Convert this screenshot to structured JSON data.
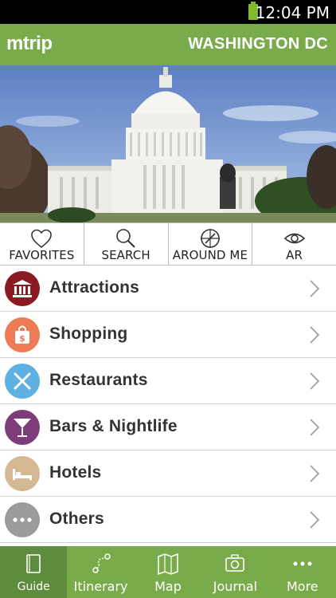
{
  "status_bar": {
    "time": "12:04 PM",
    "battery_color": "#7fba2a"
  },
  "header": {
    "logo": "mtrip",
    "city": "WASHINGTON DC",
    "color": "#7aab4a"
  },
  "hero": {
    "image": "capitol-building-photo"
  },
  "quick_actions": [
    {
      "label": "FAVORITES",
      "icon": "heart-icon"
    },
    {
      "label": "SEARCH",
      "icon": "magnifier-icon"
    },
    {
      "label": "AROUND ME",
      "icon": "crosshair-icon"
    },
    {
      "label": "AR",
      "icon": "eye-icon"
    }
  ],
  "categories": [
    {
      "label": "Attractions",
      "icon": "building-icon",
      "color": "#8b1a22"
    },
    {
      "label": "Shopping",
      "icon": "shopping-bag-icon",
      "color": "#ec7b56"
    },
    {
      "label": "Restaurants",
      "icon": "fork-knife-icon",
      "color": "#5eb1e0"
    },
    {
      "label": "Bars & Nightlife",
      "icon": "cocktail-icon",
      "color": "#7e3d7a"
    },
    {
      "label": "Hotels",
      "icon": "bed-icon",
      "color": "#d3b893"
    },
    {
      "label": "Others",
      "icon": "dots-icon",
      "color": "#9b9b9b"
    }
  ],
  "bottom_nav": [
    {
      "label": "Guide",
      "icon": "book-icon",
      "active": true
    },
    {
      "label": "Itinerary",
      "icon": "route-icon",
      "active": false
    },
    {
      "label": "Map",
      "icon": "map-icon",
      "active": false
    },
    {
      "label": "Journal",
      "icon": "camera-icon",
      "active": false
    },
    {
      "label": "More",
      "icon": "more-dots-icon",
      "active": false
    }
  ]
}
